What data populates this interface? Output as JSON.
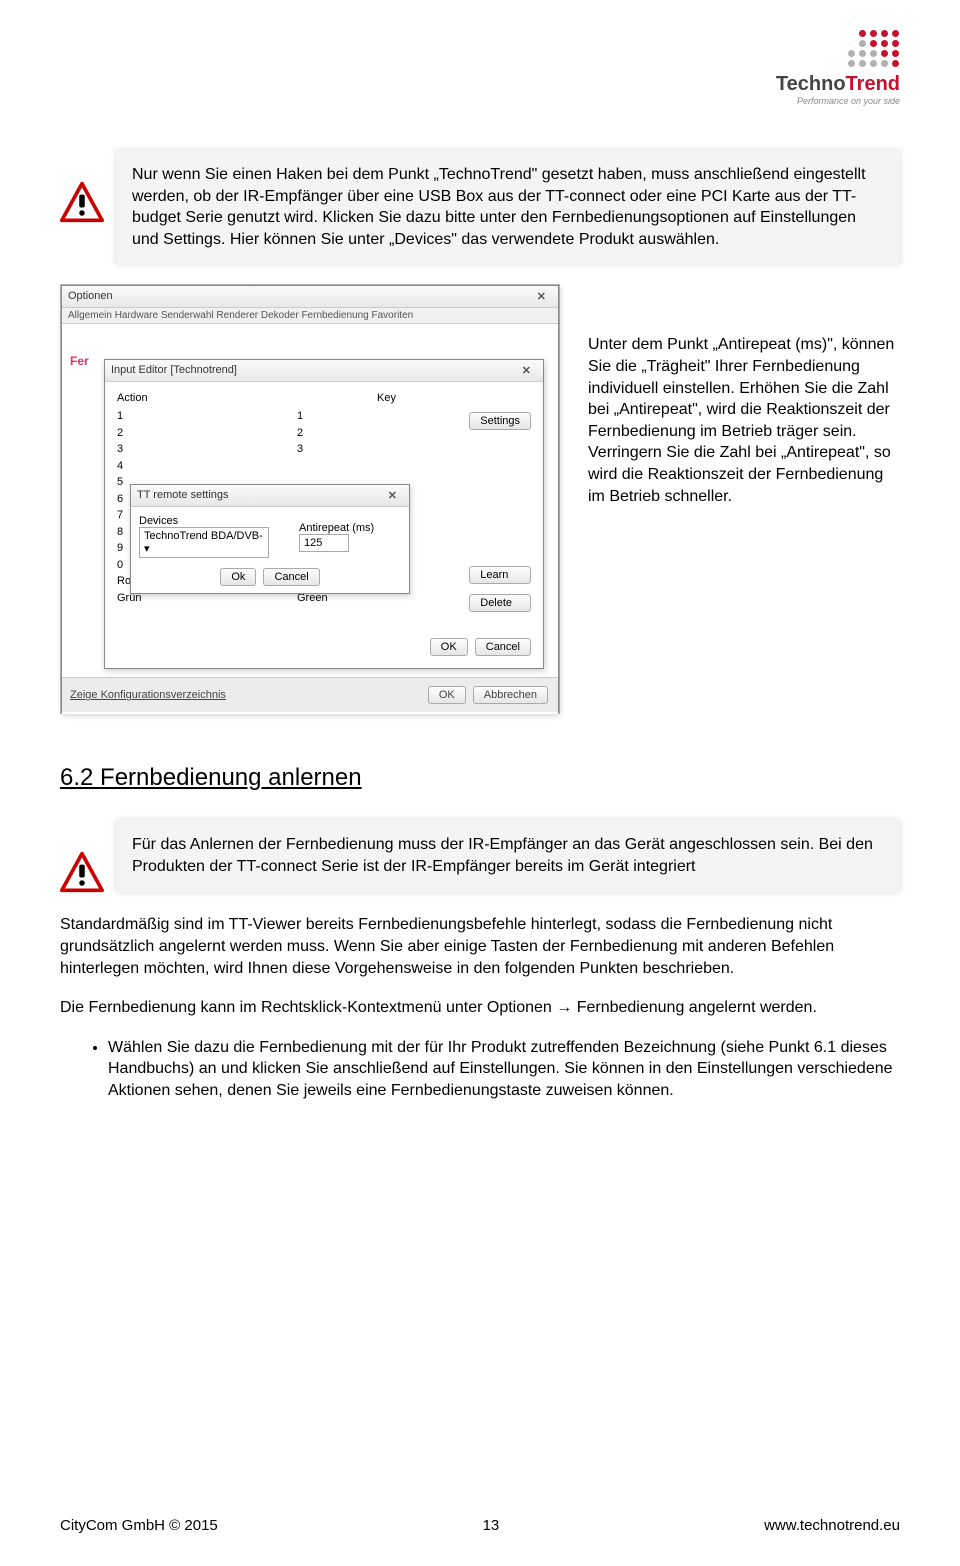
{
  "logo": {
    "brand1": "Techno",
    "brand2": "Trend",
    "tagline": "Performance on your side"
  },
  "warning1": {
    "text": "Nur wenn Sie einen Haken bei dem Punkt „TechnoTrend\" gesetzt haben, muss anschließend eingestellt werden, ob der IR-Empfänger über eine USB Box aus der TT-connect oder eine PCI Karte aus der TT-budget Serie genutzt wird. Klicken Sie dazu bitte unter den Fernbedienungsoptionen auf Einstellungen und Settings. Hier können Sie unter „Devices\" das verwendete Produkt auswählen."
  },
  "screenshot": {
    "win_options_title": "Optionen",
    "tabs": "Allgemein   Hardware   Senderwahl   Renderer   Dekoder   Fernbedienung   Favoriten",
    "fer_label": "Fer",
    "input_editor_title": "Input Editor [Technotrend]",
    "col_action": "Action",
    "col_key": "Key",
    "rows": [
      "1",
      "2",
      "3",
      "4",
      "5",
      "6",
      "7",
      "8",
      "9",
      "0",
      "Rot",
      "Grün"
    ],
    "keys": [
      "1",
      "2",
      "3",
      "",
      "",
      "",
      "",
      "",
      "",
      "",
      "",
      "Green"
    ],
    "side_settings": "Settings",
    "side_learn": "Learn",
    "side_delete": "Delete",
    "inner_ok": "OK",
    "inner_cancel": "Cancel",
    "tt_remote_title": "TT remote settings",
    "devices_label": "Devices",
    "antirepeat_label": "Antirepeat (ms)",
    "device_value": "TechnoTrend BDA/DVB-",
    "antirepeat_value": "125",
    "tt_ok": "Ok",
    "tt_cancel": "Cancel",
    "bottom_link": "Zeige Konfigurationsverzeichnis",
    "bottom_ok": "OK",
    "bottom_cancel": "Abbrechen"
  },
  "side_text": "Unter dem Punkt „Antirepeat (ms)\", können Sie die „Trägheit\" Ihrer Fernbedienung individuell einstellen. Erhöhen Sie die Zahl bei „Antirepeat\", wird die Reaktionszeit der Fernbedienung im Betrieb träger sein. Verringern Sie die Zahl bei „Antirepeat\", so wird die Reaktionszeit der Fernbedienung im Betrieb schneller.",
  "heading": "6.2 Fernbedienung anlernen",
  "warning2": {
    "text": "Für das Anlernen der Fernbedienung muss der IR-Empfänger an das Gerät angeschlossen sein. Bei den Produkten der TT-connect Serie ist der IR-Empfänger bereits im Gerät integriert"
  },
  "para1": "Standardmäßig sind im TT-Viewer bereits Fernbedienungsbefehle hinterlegt, sodass die Fernbedienung nicht grundsätzlich angelernt werden muss. Wenn Sie aber einige Tasten der Fernbedienung mit anderen Befehlen hinterlegen möchten, wird Ihnen diese Vorgehensweise in den folgenden Punkten beschrieben.",
  "para2": "Die Fernbedienung kann im Rechtsklick-Kontextmenü unter Optionen → Fernbedienung angelernt werden.",
  "bullet1": "Wählen Sie dazu die Fernbedienung mit der für Ihr Produkt zutreffenden Bezeichnung (siehe Punkt 6.1 dieses Handbuchs) an und klicken Sie anschließend auf Einstellungen. Sie können in den Einstellungen verschiedene Aktionen sehen, denen Sie jeweils eine Fernbedienungstaste zuweisen können.",
  "footer": {
    "left": "CityCom GmbH © 2015",
    "center": "13",
    "right": "www.technotrend.eu"
  }
}
